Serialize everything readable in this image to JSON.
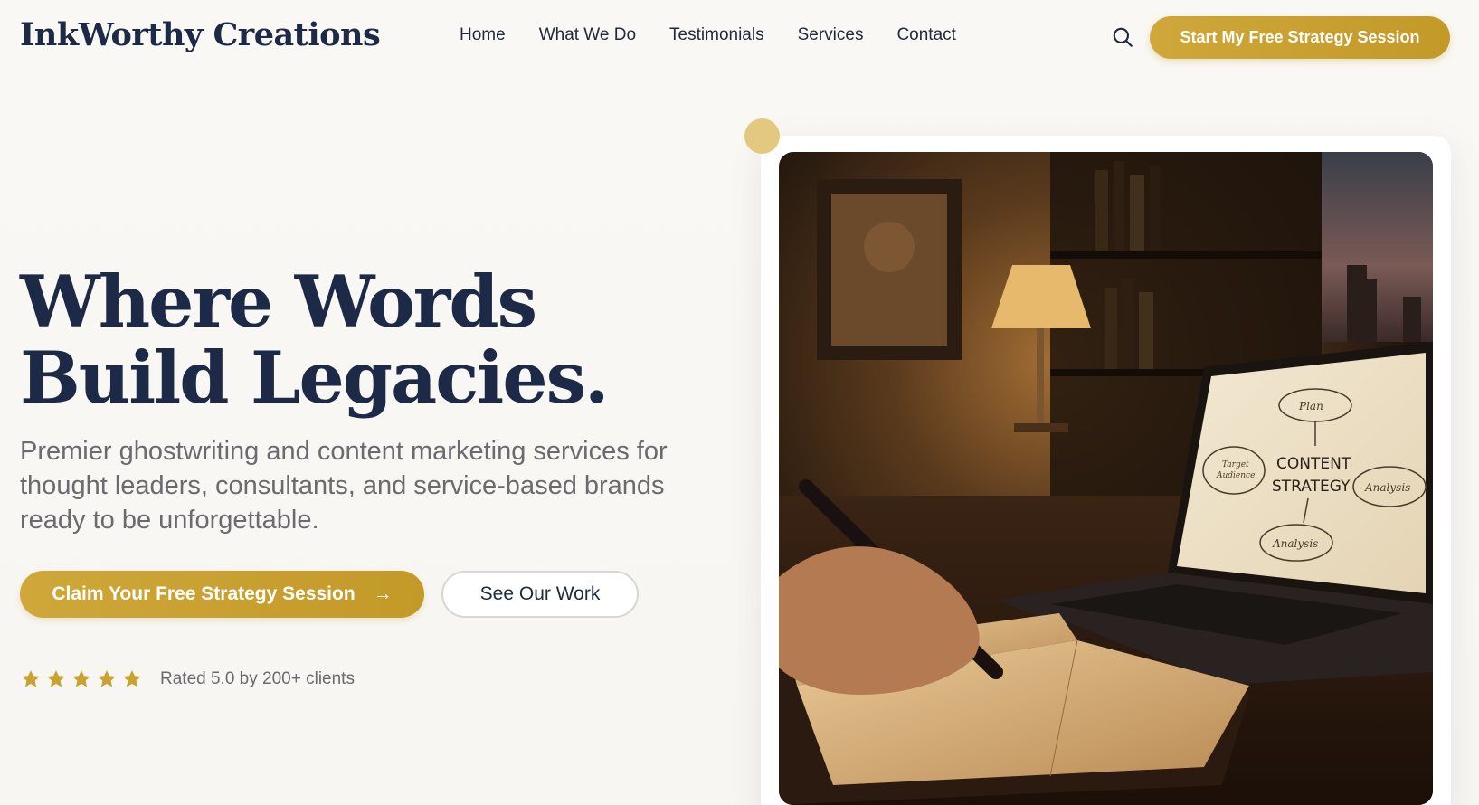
{
  "nav": {
    "logo": "InkWorthy Creations",
    "items": [
      "Home",
      "What We Do",
      "Testimonials",
      "Services",
      "Contact"
    ],
    "cta": "Start My Free Strategy Session"
  },
  "hero": {
    "headline_line1": "Where Words",
    "headline_line2": "Build Legacies.",
    "subtext": "Premier ghostwriting and content marketing services for thought leaders, consultants, and service-based brands ready to be unforgettable.",
    "primary_button": "Claim Your Free Strategy Session",
    "primary_button_arrow": "→",
    "secondary_button": "See Our Work",
    "rating_text": "Rated 5.0 by 200+ clients",
    "star_count": 5
  },
  "photo": {
    "screen_center": "CONTENT",
    "screen_center2": "STRATEGY",
    "screen_plan": "Plan",
    "screen_target": "Target",
    "screen_target2": "Audience",
    "screen_analysis": "Analysis",
    "screen_analysis2": "Analysis"
  },
  "colors": {
    "navy": "#1c2a47",
    "gold": "#c9a232",
    "muted_text": "#6a6a6f"
  }
}
